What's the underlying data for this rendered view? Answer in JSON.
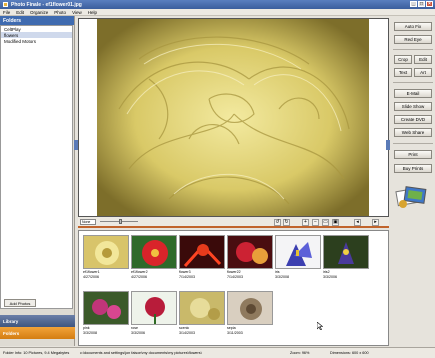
{
  "window": {
    "title": "Photo Finale  -  ef1flower01.jpg"
  },
  "menu": [
    "File",
    "Edit",
    "Organize",
    "Photo",
    "View",
    "Help"
  ],
  "sidebar": {
    "header": "Folders",
    "folders": [
      "CeltPlay",
      "flowers",
      "Modified Motors"
    ],
    "selected_index": 1,
    "add_photos_label": "Add Photos",
    "tabs": {
      "library": "Library",
      "folders": "Folders"
    }
  },
  "viewer": {
    "zoom": "None"
  },
  "thumbnails": [
    {
      "name": "ef1flower1",
      "date": "4/27/2006"
    },
    {
      "name": "ef1flower2",
      "date": "4/27/2006"
    },
    {
      "name": "flower3",
      "date": "7/14/2003"
    },
    {
      "name": "flower22",
      "date": "7/14/2003"
    },
    {
      "name": "iris",
      "date": "3/3/2008"
    },
    {
      "name": "iris2",
      "date": "3/3/2006"
    },
    {
      "name": "pink",
      "date": "3/3/2008"
    },
    {
      "name": "rose",
      "date": "3/3/2006"
    },
    {
      "name": "scenic",
      "date": "3/14/2003"
    },
    {
      "name": "sepia",
      "date": "3/11/2003"
    }
  ],
  "right_buttons": {
    "auto_fix": "Auto Fix",
    "red_eye": "Red Eye",
    "crop": "Crop",
    "edit": "Edit",
    "text": "Text",
    "art": "Art",
    "email": "E-Mail",
    "slide_show": "Slide Show",
    "create_dvd": "Create DVD",
    "web_share": "Web Share",
    "print": "Print",
    "buy_prints": "Buy Prints"
  },
  "status": {
    "folder_info": "Folder Info: 10 Pictures, 9.4 Megabytes",
    "path": "c:\\documents and settings\\jon faison\\my documents\\my pictures\\flowers\\",
    "zoom": "Zoom: 96%",
    "dimensions": "Dimensions: 600 x 600"
  },
  "colors": {
    "title_bar": "#3b5e9d",
    "folders_tab": "#e3911f",
    "accent_line": "#c1642c"
  }
}
